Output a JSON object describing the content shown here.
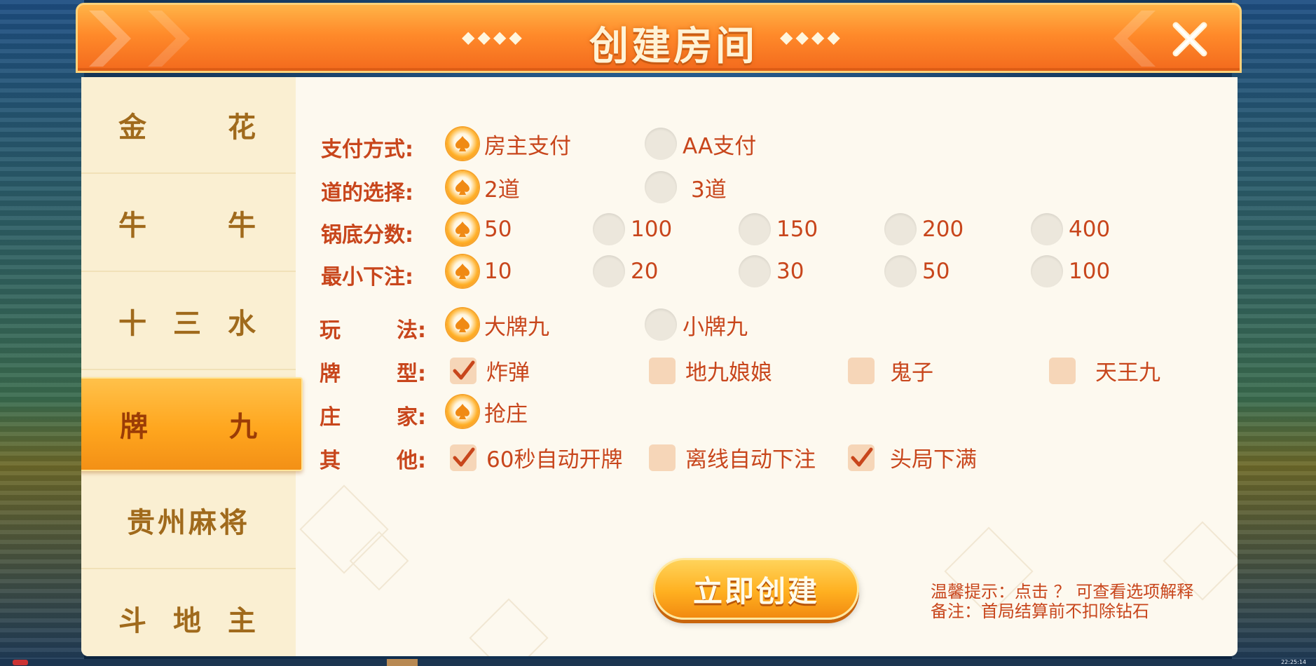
{
  "dialog": {
    "title": "创建房间",
    "title_deco_left": "◆◆◆◆",
    "title_deco_right": "◆◆◆◆"
  },
  "sidebar": {
    "items": [
      {
        "chars": [
          "金",
          "花"
        ]
      },
      {
        "chars": [
          "牛",
          "牛"
        ]
      },
      {
        "chars": [
          "十",
          "三",
          "水"
        ]
      },
      {
        "chars": [
          "牌",
          "九"
        ],
        "active": true
      },
      {
        "label": "贵州麻将"
      },
      {
        "chars": [
          "斗",
          "地",
          "主"
        ]
      }
    ]
  },
  "options": {
    "payment": {
      "label": "支付方式:",
      "choices": [
        "房主支付",
        "AA支付"
      ],
      "selected": 0
    },
    "road": {
      "label": "道的选择:",
      "choices": [
        "2道",
        "3道"
      ],
      "selected": 0
    },
    "base_score": {
      "label": "锅底分数:",
      "choices": [
        "50",
        "100",
        "150",
        "200",
        "400"
      ],
      "selected": 0
    },
    "min_bet": {
      "label": "最小下注:",
      "choices": [
        "10",
        "20",
        "30",
        "50",
        "100"
      ],
      "selected": 0
    },
    "play": {
      "label_chars": [
        "玩",
        "法:"
      ],
      "choices": [
        "大牌九",
        "小牌九"
      ],
      "selected": 0
    },
    "card_type": {
      "label_chars": [
        "牌",
        "型:"
      ],
      "choices": [
        "炸弹",
        "地九娘娘",
        "鬼子",
        "天王九"
      ],
      "checked": [
        true,
        false,
        false,
        false
      ]
    },
    "banker": {
      "label_chars": [
        "庄",
        "家:"
      ],
      "choices": [
        "抢庄"
      ],
      "selected": 0
    },
    "other": {
      "label_chars": [
        "其",
        "他:"
      ],
      "choices": [
        "60秒自动开牌",
        "离线自动下注",
        "头局下满"
      ],
      "checked": [
        true,
        false,
        true
      ]
    }
  },
  "create_button": "立即创建",
  "tips": {
    "line1": "温馨提示：点击 ？ 可查看选项解释",
    "line2": "备注：首局结算前不扣除钻石"
  },
  "taskbar": {
    "clock": "22:25:14"
  },
  "colors": {
    "accent": "#c8461c",
    "gold": "#ffa61e",
    "panel": "#fdf9ef"
  }
}
